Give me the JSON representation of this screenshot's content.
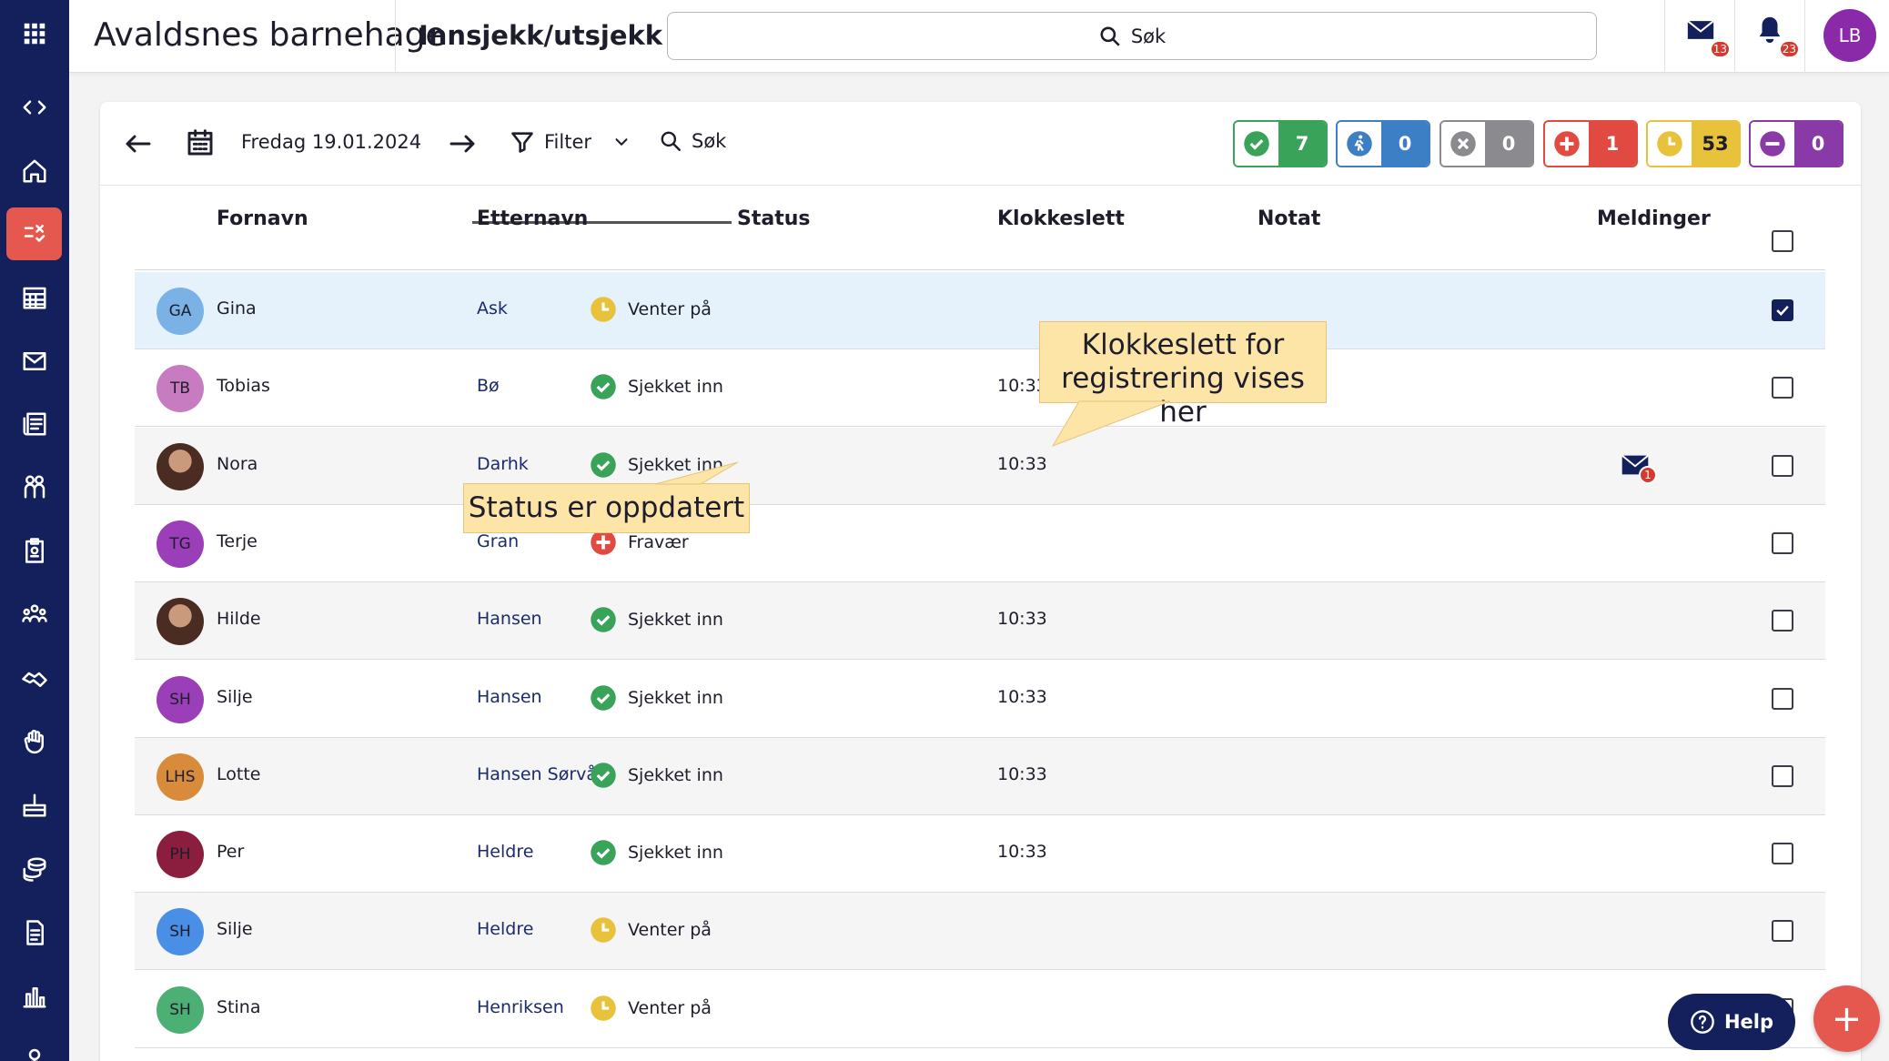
{
  "header": {
    "org_name": "Avaldsnes barnehage",
    "page_name": "Innsjekk/utsjekk",
    "search_label": "Søk",
    "mail_badge": "13",
    "notif_badge": "23",
    "user_initials": "LB"
  },
  "sidebar": {
    "items": [
      "apps-grid-icon",
      "collapse-icon",
      "home-icon",
      "checkin-icon",
      "calendar-icon",
      "mail-icon",
      "news-icon",
      "children-icon",
      "badge-icon",
      "groups-icon",
      "handshake-icon",
      "hand-icon",
      "birthday-icon",
      "money-icon",
      "document-icon",
      "chart-icon",
      "person-icon"
    ],
    "active": "checkin-icon"
  },
  "toolbar": {
    "date": "Fredag 19.01.2024",
    "filter_label": "Filter",
    "search_label": "Søk",
    "counters": [
      {
        "name": "checked-in",
        "value": "7",
        "color": "#3aa35a"
      },
      {
        "name": "walking",
        "value": "0",
        "color": "#3d7fc4"
      },
      {
        "name": "absent",
        "value": "0",
        "color": "#8a8a8f"
      },
      {
        "name": "sick",
        "value": "1",
        "color": "#e04a40"
      },
      {
        "name": "waiting",
        "value": "53",
        "color": "#e8c23a"
      },
      {
        "name": "off",
        "value": "0",
        "color": "#8a3aa6"
      }
    ]
  },
  "table": {
    "columns": [
      "Fornavn",
      "Etternavn",
      "Status",
      "Klokkeslett",
      "Notat",
      "Meldinger"
    ],
    "rows": [
      {
        "initials": "GA",
        "first": "Gina",
        "last": "Ask",
        "status": "Venter på",
        "time": "",
        "checked": true
      },
      {
        "initials": "TB",
        "first": "Tobias",
        "last": "Bø",
        "status": "Sjekket inn",
        "time": "10:33",
        "checked": false
      },
      {
        "initials": "",
        "first": "Nora",
        "last": "Darhk",
        "status": "Sjekket inn",
        "time": "10:33",
        "messages": "1",
        "checked": false
      },
      {
        "initials": "TG",
        "first": "Terje",
        "last": "Gran",
        "status": "Fravær",
        "time": "",
        "checked": false
      },
      {
        "initials": "",
        "first": "Hilde",
        "last": "Hansen",
        "status": "Sjekket inn",
        "time": "10:33",
        "checked": false
      },
      {
        "initials": "SH",
        "first": "Silje",
        "last": "Hansen",
        "status": "Sjekket inn",
        "time": "10:33",
        "checked": false
      },
      {
        "initials": "LHS",
        "first": "Lotte",
        "last": "Hansen Sørvåg",
        "status": "Sjekket inn",
        "time": "10:33",
        "checked": false
      },
      {
        "initials": "PH",
        "first": "Per",
        "last": "Heldre",
        "status": "Sjekket inn",
        "time": "10:33",
        "checked": false
      },
      {
        "initials": "SH",
        "first": "Silje",
        "last": "Heldre",
        "status": "Venter på",
        "time": "",
        "checked": false
      },
      {
        "initials": "SH",
        "first": "Stina",
        "last": "Henriksen",
        "status": "Venter på",
        "time": "",
        "checked": false
      }
    ]
  },
  "callouts": {
    "time_note": "Klokkeslett for registrering vises her",
    "status_note": "Status er oppdatert"
  },
  "help_label": "Help",
  "fab_label": "+"
}
